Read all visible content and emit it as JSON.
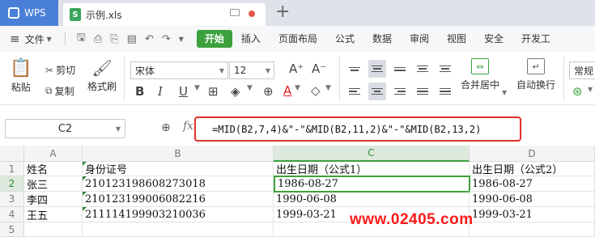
{
  "titlebar": {
    "app_name": "WPS",
    "file_name": "示例.xls",
    "file_icon_letter": "S",
    "new_tab_symbol": "+"
  },
  "menubar": {
    "file_menu": "文件",
    "tabs": [
      "开始",
      "插入",
      "页面布局",
      "公式",
      "数据",
      "审阅",
      "视图",
      "安全",
      "开发工"
    ],
    "active_tab": "开始"
  },
  "ribbon": {
    "paste": "粘贴",
    "cut": "剪切",
    "copy": "复制",
    "format_painter": "格式刷",
    "font_name": "宋体",
    "font_size": "12",
    "increase_font": "A⁺",
    "decrease_font": "A⁻",
    "bold": "B",
    "italic": "I",
    "underline": "U",
    "font_color": "A",
    "merge_center": "合并居中",
    "auto_wrap": "自动换行",
    "number_format": "常规",
    "accent_color": "#3ca13c"
  },
  "formula_bar": {
    "cell_ref": "C2",
    "fx": "fx",
    "formula": "=MID(B2,7,4)&\"-\"&MID(B2,11,2)&\"-\"&MID(B2,13,2)",
    "highlight_color": "#e0302a"
  },
  "sheet": {
    "columns": [
      "A",
      "B",
      "C",
      "D"
    ],
    "active_column": "C",
    "rows": [
      "1",
      "2",
      "3",
      "4",
      "5"
    ],
    "active_row": "2",
    "cells": {
      "A1": "姓名",
      "B1": "身份证号",
      "C1": "出生日期（公式1）",
      "D1": "出生日期（公式2）",
      "A2": "张三",
      "B2": "210123198608273018",
      "C2": "1986-08-27",
      "D2": "1986-08-27",
      "A3": "李四",
      "B3": "210123199006082216",
      "C3": "1990-06-08",
      "D3": "1990-06-08",
      "A4": "王五",
      "B4": "211114199903210036",
      "C4": "1999-03-21",
      "D4": "1999-03-21"
    }
  },
  "watermark": "www.02405.com"
}
